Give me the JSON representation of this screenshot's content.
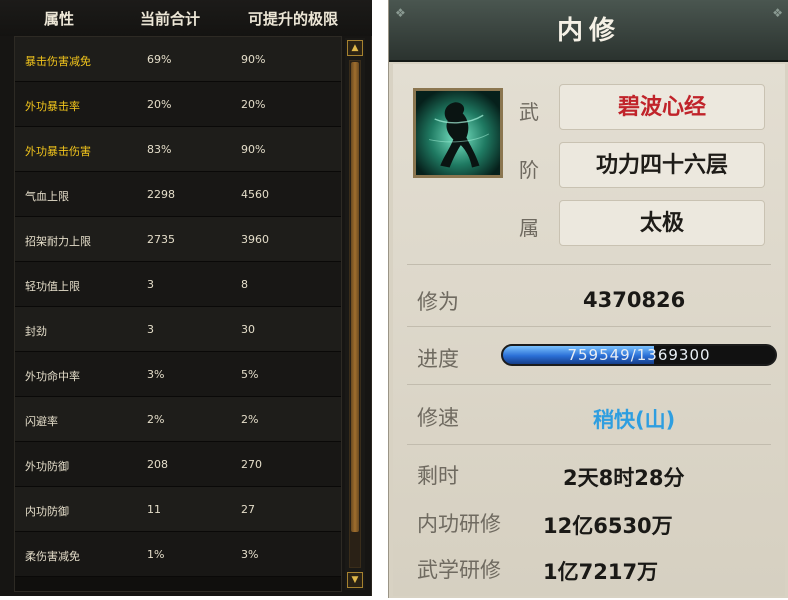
{
  "attributes_panel": {
    "headers": {
      "name": "属性",
      "current": "当前合计",
      "max": "可提升的极限"
    },
    "rows": [
      {
        "name": "暴击伤害减免",
        "current": "69%",
        "max": "90%",
        "highlight": true
      },
      {
        "name": "外功暴击率",
        "current": "20%",
        "max": "20%",
        "highlight": true
      },
      {
        "name": "外功暴击伤害",
        "current": "83%",
        "max": "90%",
        "highlight": true
      },
      {
        "name": "气血上限",
        "current": "2298",
        "max": "4560",
        "highlight": false
      },
      {
        "name": "招架耐力上限",
        "current": "2735",
        "max": "3960",
        "highlight": false
      },
      {
        "name": "轻功值上限",
        "current": "3",
        "max": "8",
        "highlight": false
      },
      {
        "name": "封劲",
        "current": "3",
        "max": "30",
        "highlight": false
      },
      {
        "name": "外功命中率",
        "current": "3%",
        "max": "5%",
        "highlight": false
      },
      {
        "name": "闪避率",
        "current": "2%",
        "max": "2%",
        "highlight": false
      },
      {
        "name": "外功防御",
        "current": "208",
        "max": "270",
        "highlight": false
      },
      {
        "name": "内功防御",
        "current": "11",
        "max": "27",
        "highlight": false
      },
      {
        "name": "柔伤害减免",
        "current": "1%",
        "max": "3%",
        "highlight": false
      }
    ],
    "scroll_up_icon": "chevron-up-icon",
    "scroll_down_icon": "chevron-down-icon"
  },
  "neixiu_panel": {
    "title": "内修",
    "skill_icon": "dancer-silhouette-icon",
    "fields": {
      "wu_label": "武",
      "wu_value": "碧波心经",
      "jie_label": "阶",
      "jie_value": "功力四十六层",
      "shu_label": "属",
      "shu_value": "太极"
    },
    "xiuwei_label": "修为",
    "xiuwei_value": "4370826",
    "progress_label": "进度",
    "progress_text": "759549/1369300",
    "progress_fraction": 0.5547,
    "speed_label": "修速",
    "speed_value": "稍快(山)",
    "remaining_label": "剩时",
    "remaining_value": "2天8时28分",
    "neigong_label": "内功研修",
    "neigong_value": "12亿6530万",
    "wuxue_label": "武学研修",
    "wuxue_value": "1亿7217万"
  },
  "colors": {
    "gold_text": "#f2c51c",
    "red_text": "#c0232a",
    "blue_text": "#2e9ee0",
    "progress_fill": "#2a6fd6"
  }
}
